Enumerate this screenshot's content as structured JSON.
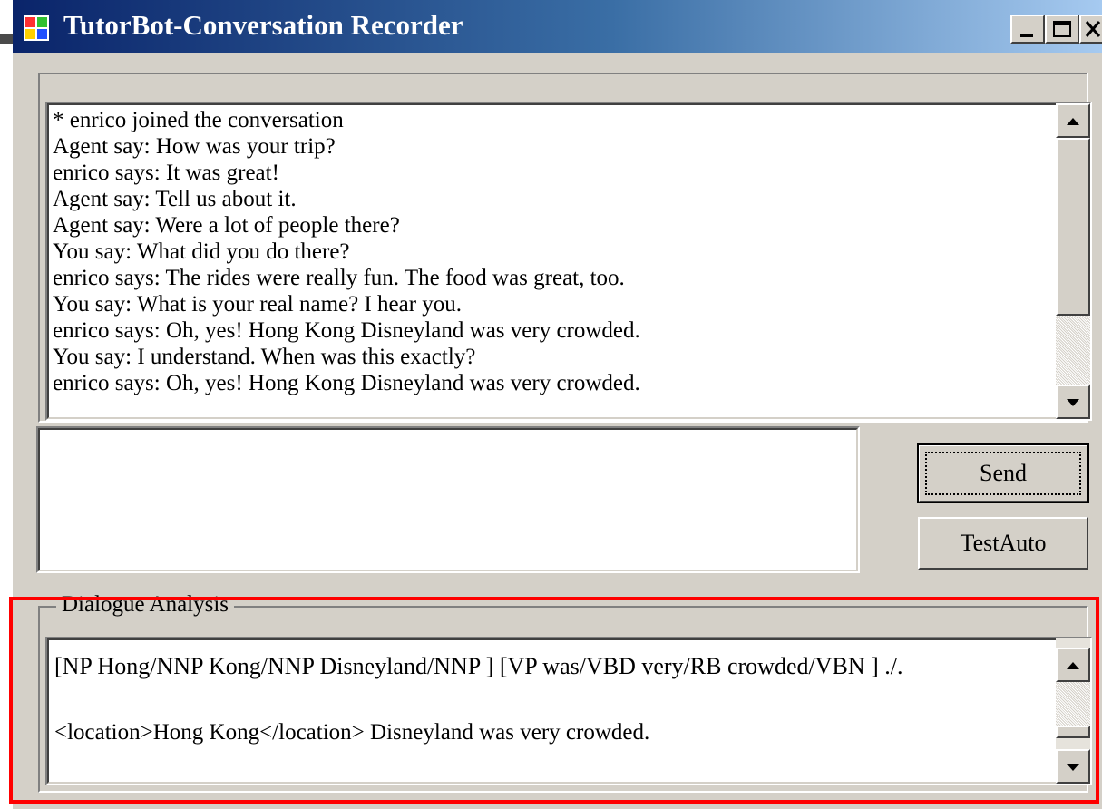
{
  "window": {
    "title": "TutorBot-Conversation Recorder",
    "controls": [
      "minimize",
      "maximize",
      "close"
    ]
  },
  "conversation": {
    "lines": [
      "* enrico joined the conversation",
      "Agent say: How was your trip?",
      "enrico says: It was great!",
      "Agent say: Tell us about it.",
      "Agent say: Were a lot of people there?",
      "You say: What did you do there?",
      "enrico says: The rides were really fun. The food was great, too.",
      "You say: What is your real name? I hear you.",
      "enrico says: Oh, yes! Hong Kong Disneyland was very crowded.",
      "You say: I understand. When was this exactly?",
      "enrico says: Oh, yes! Hong Kong Disneyland was very crowded."
    ]
  },
  "input": {
    "value": ""
  },
  "buttons": {
    "send": "Send",
    "test_auto": "TestAuto"
  },
  "analysis": {
    "group_label": "Dialogue Analysis",
    "parse_line": "[NP Hong/NNP Kong/NNP Disneyland/NNP ] [VP was/VBD very/RB crowded/VBN ] ./.",
    "ner_line": "<location>Hong Kong</location> Disneyland was very crowded."
  },
  "colors": {
    "window_bg": "#d4d0c8",
    "titlebar_start": "#0a246a",
    "titlebar_end": "#a6caf0",
    "highlight": "#ff0000"
  },
  "icons": [
    "app-icon",
    "minimize-icon",
    "maximize-icon",
    "close-icon",
    "arrow-up-icon",
    "arrow-down-icon"
  ]
}
